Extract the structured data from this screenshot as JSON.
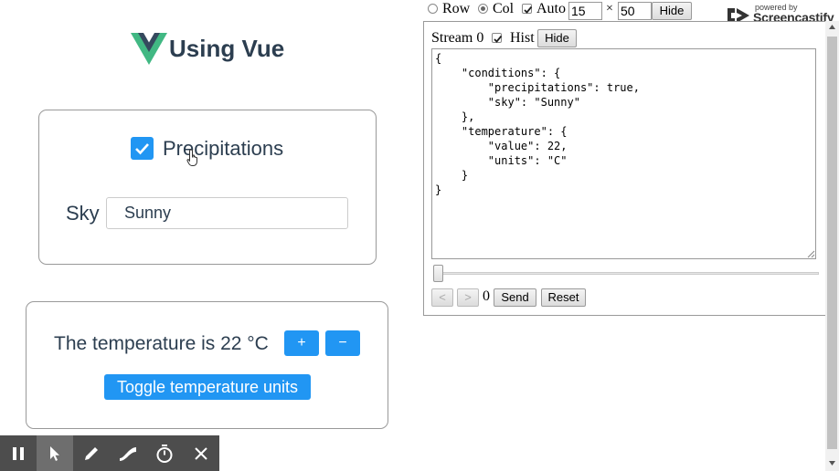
{
  "app": {
    "title": "Using Vue",
    "precipitations_label": "Precipitations",
    "precipitations_checked": true,
    "sky_label": "Sky",
    "sky_value": "Sunny",
    "temperature_text": "The temperature is 22 °C",
    "plus_label": "+",
    "minus_label": "−",
    "toggle_units_label": "Toggle temperature units",
    "accent_color": "#2196f3",
    "text_color": "#2c3e50"
  },
  "debugger": {
    "row_label": "Row",
    "col_label": "Col",
    "auto_label": "Auto",
    "layout_selected": "Col",
    "auto_checked": true,
    "rows_value": "15",
    "times_symbol": "×",
    "cols_value": "50",
    "top_hide_label": "Hide",
    "stream_label": "Stream 0",
    "hist_label": "Hist",
    "hist_checked": true,
    "hide_label": "Hide",
    "json_text": "{\n    \"conditions\": {\n        \"precipitations\": true,\n        \"sky\": \"Sunny\"\n    },\n    \"temperature\": {\n        \"value\": 22,\n        \"units\": \"C\"\n    }\n}",
    "prev_label": "<",
    "next_label": ">",
    "index_value": "0",
    "send_label": "Send",
    "reset_label": "Reset",
    "slider_position": 0
  },
  "badge": {
    "powered_by": "powered by",
    "brand": "Screencastify"
  },
  "recorder_toolbar": {
    "tools": [
      "pause-icon",
      "pointer-icon",
      "pen-icon",
      "eraser-icon",
      "timer-icon",
      "close-icon"
    ],
    "active_tool": "pointer-icon"
  }
}
